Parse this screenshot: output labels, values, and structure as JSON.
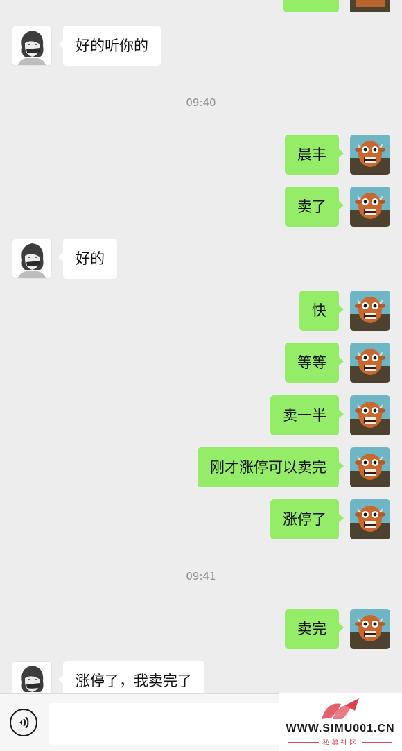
{
  "messages": [
    {
      "type": "text",
      "side": "left",
      "text": "好的听你的"
    },
    {
      "type": "time",
      "text": "09:40"
    },
    {
      "type": "text",
      "side": "right",
      "text": "晨丰"
    },
    {
      "type": "text",
      "side": "right",
      "text": "卖了"
    },
    {
      "type": "text",
      "side": "left",
      "text": "好的"
    },
    {
      "type": "text",
      "side": "right",
      "text": "快"
    },
    {
      "type": "text",
      "side": "right",
      "text": "等等"
    },
    {
      "type": "text",
      "side": "right",
      "text": "卖一半"
    },
    {
      "type": "text",
      "side": "right",
      "text": "刚才涨停可以卖完"
    },
    {
      "type": "text",
      "side": "right",
      "text": "涨停了"
    },
    {
      "type": "time",
      "text": "09:41"
    },
    {
      "type": "text",
      "side": "right",
      "text": "卖完"
    },
    {
      "type": "text",
      "side": "left",
      "text": "涨停了，我卖完了"
    }
  ],
  "input_bar": {
    "voice_icon": "voice-icon",
    "input_value": ""
  },
  "watermark": {
    "site": "WWW.SIMU001.CN",
    "subtitle": "私募社区"
  },
  "colors": {
    "background": "#ededed",
    "own_bubble": "#95ec69",
    "other_bubble": "#ffffff",
    "time_text": "#8e8e8e"
  }
}
